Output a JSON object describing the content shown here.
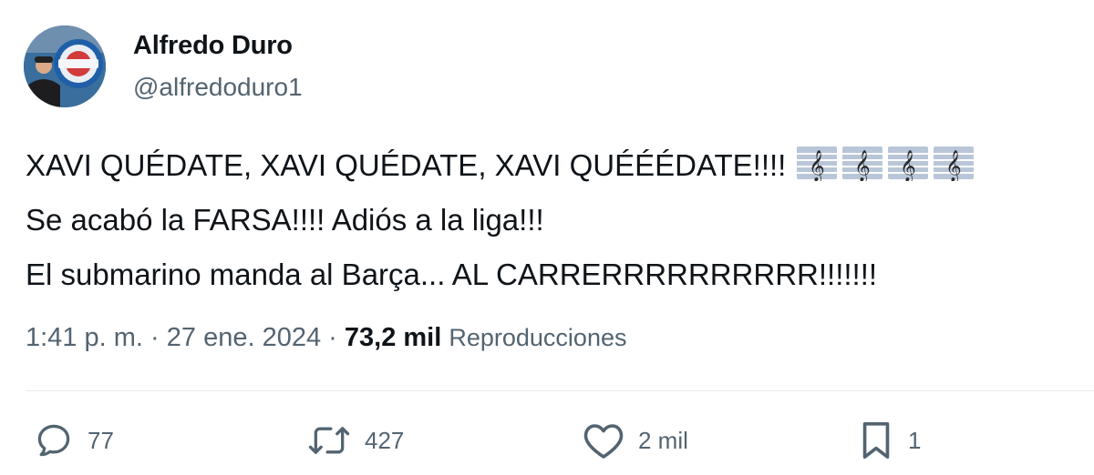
{
  "author": {
    "name": "Alfredo Duro",
    "handle": "@alfredoduro1"
  },
  "tweet": {
    "lines": [
      "XAVI QUÉDATE, XAVI QUÉDATE, XAVI QUÉÉÉDATE!!!!",
      "Se acabó la FARSA!!!! Adiós a la liga!!!",
      "El submarino manda al Barça... AL CARRERRRRRRRRRR!!!!!!!"
    ],
    "emoji": [
      "musical-score",
      "musical-score",
      "musical-score",
      "musical-score"
    ]
  },
  "meta": {
    "time": "1:41 p. m.",
    "separator": "·",
    "date": "27 ene. 2024",
    "views_count": "73,2 mil",
    "views_label": "Reproducciones"
  },
  "actions": {
    "replies": {
      "icon": "reply-icon",
      "count": "77"
    },
    "reposts": {
      "icon": "repost-icon",
      "count": "427"
    },
    "likes": {
      "icon": "heart-icon",
      "count": "2 mil"
    },
    "bookmarks": {
      "icon": "bookmark-icon",
      "count": "1"
    }
  },
  "colors": {
    "text": "#0f1419",
    "secondary": "#536471",
    "divider": "#e6ecf0"
  }
}
